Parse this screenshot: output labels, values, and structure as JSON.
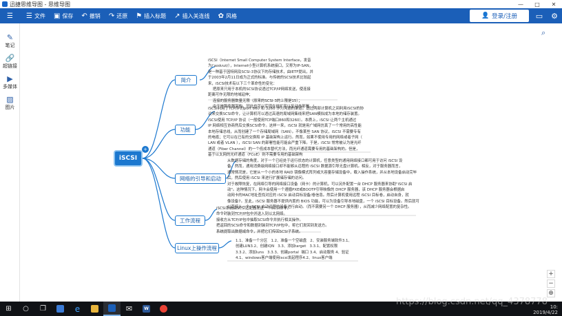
{
  "window": {
    "title": "迅捷思维导图 - 思维导图"
  },
  "window_controls": [
    "—",
    "□",
    "✕"
  ],
  "toolbar": {
    "menu_icon": "menu-icon",
    "items": [
      {
        "icon": "file-icon",
        "label": "文件"
      },
      {
        "icon": "save-icon",
        "label": "保存"
      },
      {
        "icon": "undo-icon",
        "label": "撤销"
      },
      {
        "icon": "redo-icon",
        "label": "还原"
      },
      {
        "icon": "insert-tag-icon",
        "label": "插入标题"
      },
      {
        "icon": "link-line-icon",
        "label": "插入关连线"
      },
      {
        "icon": "style-icon",
        "label": "风格"
      }
    ],
    "login_label": "登录/注册"
  },
  "sidebar": {
    "items": [
      {
        "icon": "pen-icon",
        "label": "笔记"
      },
      {
        "icon": "link-icon",
        "label": "超链接"
      },
      {
        "icon": "media-icon",
        "label": "多媒体"
      },
      {
        "icon": "image-icon",
        "label": "图片"
      }
    ]
  },
  "mindmap": {
    "root": "iSCSI",
    "root_badge": "+",
    "branches": [
      {
        "label": "简介",
        "note": "iSCSI（Internet Small Computer System Interface，发音\n为/ˈaɪskʌzi/），Internet小型计算机系统接口，又称为IP-SAN，\n是一种基于因特网及SCSI-3协议下的存储技术，由IETF提出，并\n于2003年2月11日成为正式的标准。与传统的SCSI技术比较起\n来，iSCSI技术有以下三个革命性的变化：\n    把原来只用于本机的SCSI协议透过TCP/IP网络发送，使连接\n距离可作无限的地域延伸；\n    连接的服务器数量无限（原来的SCSI-3的上限是15）；\n    由于是服务器架构，因此也可以实现在线扩容以至动态部署。["
      },
      {
        "label": "功能",
        "note": "iSCSI利用了TCP/IP的port 860 和 3260 作为沟通的渠道。透过两部计算机之间利用iSCSI的协\n议来交换SCSI命令，让计算机可以透过高速的局域网集线来把SAN模拟成为本地的储存装置。\niSCSI使用 TCP/IP 协议（一般使用TCP端口860和3260）。本质上，iSCSI 让两个主机通过\nIP 网络相互协商然后交换SCSI命令。这样一来，iSCSI 就是用广域网仿真了一个常用的高性能\n本地存储总线，从而创建了一个存储局域网（SAN）。不像某些 SAN 协议，iSCSI 不需要专有\n的电缆；它可以在已有的交换和 IP 基础架构上运行。然而，如果不使用专用的网络或者子网（\nLAN 或者 VLAN ），iSCSI SAN 的部署性能可能会严重下降。于是，iSCSI 常常被认为是光纤\n通道（Fiber Channel）的一个低成本替代方法，而光纤通道需要专用的基础架构的。但是，\n基于以太网的光纤通道（FCoE）则不需要专用的基础架构"
      },
      {
        "label": "网络的引导和启动",
        "note": "从数据存储的角度，对于一个已经处于运行状态的计算机，任意类型的通用网络接口都可用于访问 iSCSI 设\n备。然而，通用消费级网络接口却不能够从远程的 iSCSI 数据源引导无盘计算机。相反，对于服务器而言，\n通常情况是，它是从一个小的本地 RAID 镜像模式阵列或大容量存储设备中，载入操作系统，并从本地设备启动完毕\n后，然后使用 iSCSI 来进行扩展储存储的访问。\n对于故障恢复，在网络引导的网络接口设备（网卡）的计算机，可以另外配置一台 DHCP 服务器来协助\"iSCSI 启\n动\"。这种情况下，网卡会使用一个遵循PXE或BOOTP引导映像的 DHCP 服务器，该 DHCP 服务器会根据启\n动网卡的MAC地址查找对应的 iSCSI 启动目标设备/卷信息。然后计算机使用远程 iSCSI 目标卷，启动自身，就\n像设备7。至此，iSCSI 服务器不提供内置的 BIOS 功能，可以为设备引导本地磁盘，一个 iSCSI 目标设备。然后就可\n以直接从一个 iSCSI 启动远程的设备进行启动。（而不需要另一个 DHCP 服务器），从而减少网络配置的复杂性。"
      },
      {
        "label": "工作流程",
        "note": "iSCSI系统由SCSI适配器发送一个SCSI命令。\n命令封装到TCP/IP包中并送入到以太网络。\n接收方从TCP/IP包中抽取SCSI命令并执行相关操作。\n把返回的SCSI命令和数据封装到TCP/IP包中，将它们发回到发送方。\n系统提取出数据或命令，并把它们传回SCSI子系统。"
      },
      {
        "label": "Linux上操作流程",
        "note": "1.1、准备一个分区   1.2、准备一个空磁盘   2、安装服务端软件3.1、\n创建LUN3.2、创建IQN   3.3、添加target   3.3.1、配置权限\n3.3.2、添加luns   3.3.3、创建portal  端口 3.4、启动服务 4、验证\n4.1、windows客户端使用iscsi发起程序4.2、linux客户端"
      }
    ]
  },
  "right_tools": {
    "search_icon": "search-icon",
    "zoom_in": "+",
    "zoom_out": "−",
    "fit": "⊕"
  },
  "taskbar": {
    "icons": [
      "windows-start-icon",
      "search-icon",
      "task-view-icon",
      "store-icon",
      "edge-icon",
      "folder-icon",
      "mindmap-app-icon",
      "mail-icon",
      "word-icon",
      "chrome-icon"
    ],
    "word_label": "W",
    "watermark": "https://blog.csdn.net/qq_4378778",
    "time": "10:",
    "date": "2019/4/22"
  },
  "colors": {
    "toolbar": "#1b5fb8",
    "root": "#1c78cf",
    "branch_border": "#1c78cf",
    "link": "#1c78cf"
  }
}
